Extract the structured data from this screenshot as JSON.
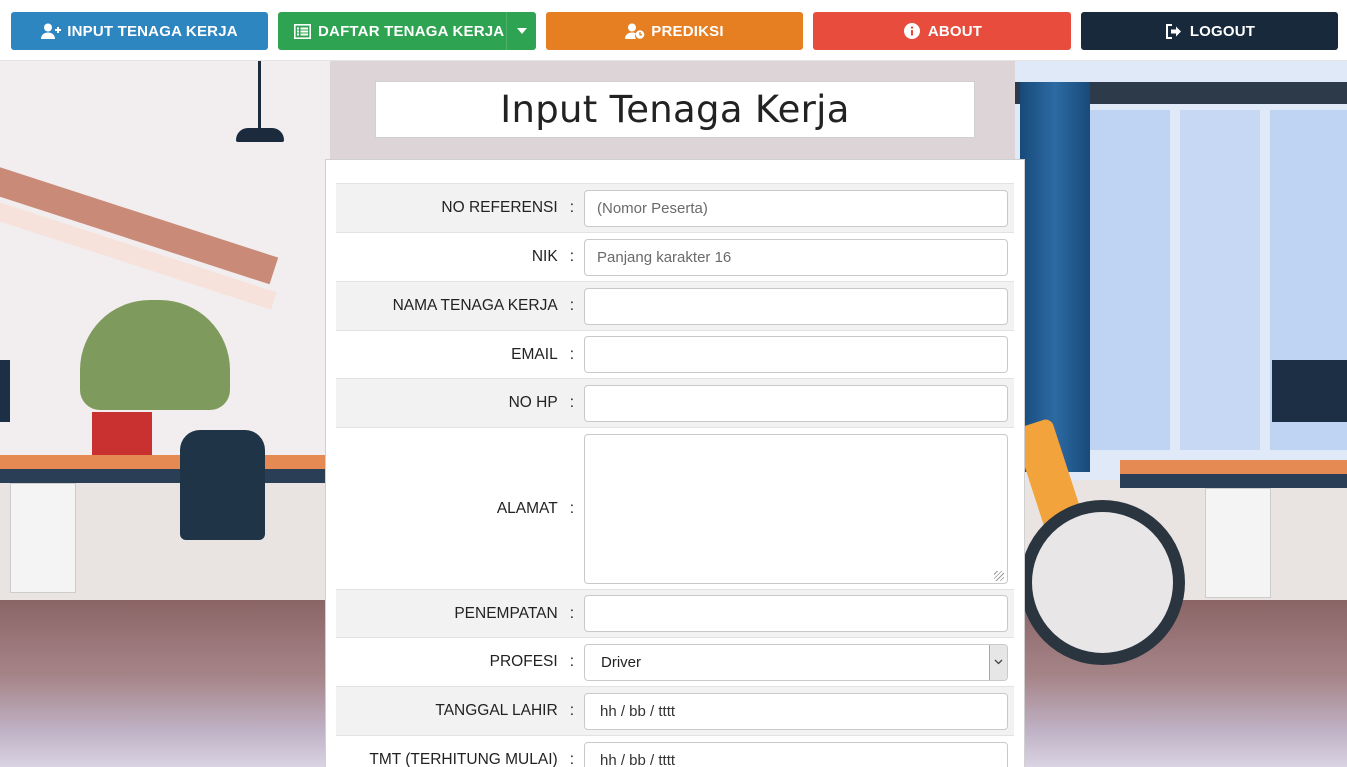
{
  "nav": {
    "input_label": "INPUT TENAGA KERJA",
    "daftar_label": "DAFTAR TENAGA KERJA",
    "prediksi_label": "PREDIKSI",
    "about_label": "ABOUT",
    "logout_label": "LOGOUT"
  },
  "icons": {
    "input": "user-plus-icon",
    "daftar": "list-icon",
    "prediksi": "user-clock-icon",
    "about": "info-circle-icon",
    "logout": "sign-out-icon",
    "dropdown": "caret-down-icon"
  },
  "colors": {
    "input": "#2e86c1",
    "daftar": "#2ea352",
    "prediksi": "#e67e22",
    "about": "#e74c3c",
    "logout": "#17293a"
  },
  "page": {
    "title": "Input Tenaga Kerja"
  },
  "form": {
    "colon": ":",
    "no_referensi": {
      "label": "NO REFERENSI",
      "placeholder": "(Nomor Peserta)",
      "value": ""
    },
    "nik": {
      "label": "NIK",
      "placeholder": "Panjang karakter 16",
      "value": ""
    },
    "nama": {
      "label": "NAMA TENAGA KERJA",
      "placeholder": "",
      "value": ""
    },
    "email": {
      "label": "EMAIL",
      "placeholder": "",
      "value": ""
    },
    "no_hp": {
      "label": "NO HP",
      "placeholder": "",
      "value": ""
    },
    "alamat": {
      "label": "ALAMAT",
      "placeholder": "",
      "value": ""
    },
    "penempatan": {
      "label": "PENEMPATAN",
      "placeholder": "",
      "value": ""
    },
    "profesi": {
      "label": "PROFESI",
      "selected": "Driver"
    },
    "tanggal_lahir": {
      "label": "TANGGAL LAHIR",
      "value": "hh / bb / tttt"
    },
    "tmt": {
      "label": "TMT (TERHITUNG MULAI)",
      "value": "hh / bb / tttt"
    }
  }
}
